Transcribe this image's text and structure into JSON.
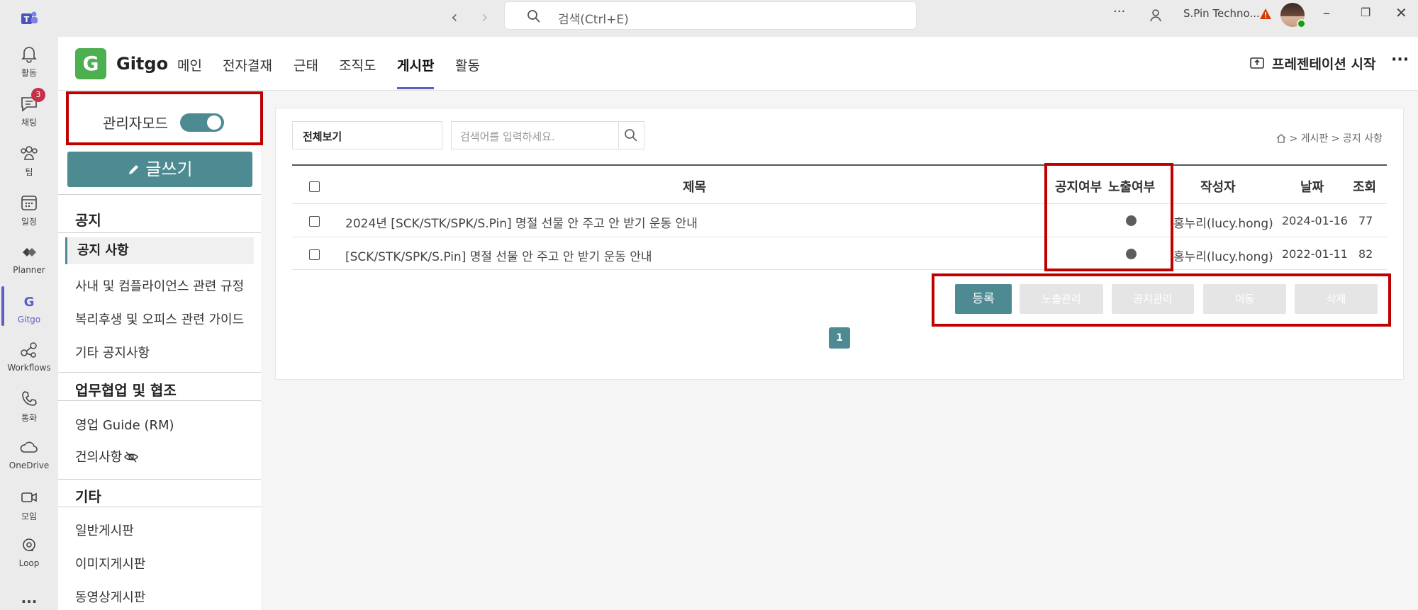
{
  "titlebar": {
    "search_placeholder": "검색(Ctrl+E)",
    "more": "···",
    "org_name": "S.Pin Techno..."
  },
  "rail": {
    "items": [
      {
        "label": "활동",
        "icon": "bell-icon"
      },
      {
        "label": "채팅",
        "icon": "chat-icon",
        "badge": "3"
      },
      {
        "label": "팀",
        "icon": "teams-icon"
      },
      {
        "label": "일정",
        "icon": "calendar-icon"
      },
      {
        "label": "Planner",
        "icon": "planner-icon"
      },
      {
        "label": "Gitgo",
        "icon": "gitgo-icon"
      },
      {
        "label": "Workflows",
        "icon": "workflows-icon"
      },
      {
        "label": "통화",
        "icon": "phone-icon"
      },
      {
        "label": "OneDrive",
        "icon": "cloud-icon"
      },
      {
        "label": "모임",
        "icon": "video-icon"
      },
      {
        "label": "Loop",
        "icon": "loop-icon"
      },
      {
        "label": "...",
        "icon": "more-icon"
      }
    ]
  },
  "header": {
    "app_name": "Gitgo",
    "tabs": [
      "메인",
      "전자결재",
      "근태",
      "조직도",
      "게시판",
      "활동"
    ],
    "active_tab": "게시판",
    "present_label": "프레젠테이션 시작",
    "more": "···"
  },
  "sidebar": {
    "admin_label": "관리자모드",
    "write_label": "글쓰기",
    "sections": [
      {
        "title": "공지",
        "items": [
          "공지 사항",
          "사내 및 컴플라이언스 관련 규정",
          "복리후생 및 오피스 관련 가이드",
          "기타 공지사항"
        ]
      },
      {
        "title": "업무협업 및 협조",
        "items": [
          "영업 Guide (RM)",
          "건의사항"
        ]
      },
      {
        "title": "기타",
        "items": [
          "일반게시판",
          "이미지게시판",
          "동영상게시판"
        ]
      }
    ]
  },
  "main": {
    "filter_value": "전체보기",
    "search_placeholder": "검색어를 입력하세요.",
    "breadcrumb": "> 게시판 > 공지 사항",
    "columns": [
      "제목",
      "공지여부",
      "노출여부",
      "작성자",
      "날짜",
      "조회"
    ],
    "rows": [
      {
        "title": "2024년 [SCK/STK/SPK/S.Pin] 명절 선물 안 주고 안 받기 운동 안내",
        "author": "홍누리(lucy.hong)",
        "date": "2024-01-16",
        "views": "77",
        "exposed": true
      },
      {
        "title": "[SCK/STK/SPK/S.Pin] 명절 선물 안 주고 안 받기 운동 안내",
        "author": "홍누리(lucy.hong)",
        "date": "2022-01-11",
        "views": "82",
        "exposed": true
      }
    ],
    "buttons": [
      "등록",
      "노출관리",
      "공지관리",
      "이동",
      "삭제"
    ],
    "page": "1"
  },
  "colors": {
    "accent": "#4d8a92",
    "highlight": "#c00000",
    "teams": "#5b5fc7",
    "gitgo": "#4caf50"
  }
}
